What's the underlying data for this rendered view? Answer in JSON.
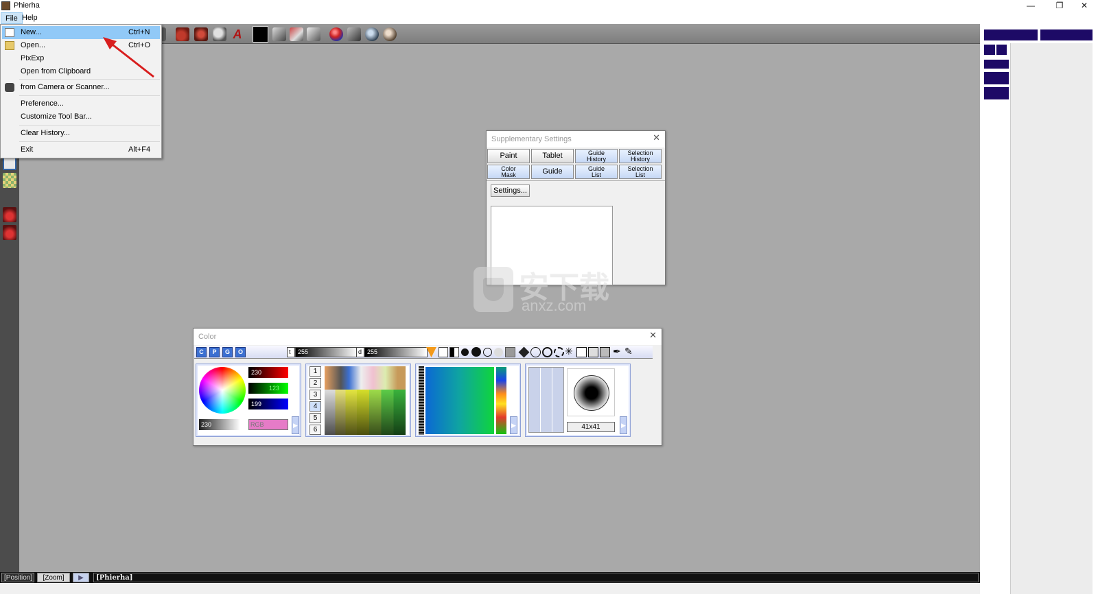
{
  "window": {
    "title": "Phierha",
    "minimize_glyph": "—",
    "restore_glyph": "❐",
    "close_glyph": "✕"
  },
  "menubar": {
    "file": "File",
    "help": "Help"
  },
  "file_menu": {
    "items": [
      {
        "label": "New...",
        "shortcut": "Ctrl+N",
        "icon": "new-document-icon"
      },
      {
        "label": "Open...",
        "shortcut": "Ctrl+O",
        "icon": "folder-icon"
      },
      {
        "label": "PixExp",
        "shortcut": ""
      },
      {
        "label": "Open from Clipboard",
        "shortcut": ""
      },
      {
        "label": "from Camera or Scanner...",
        "shortcut": "",
        "icon": "camera-icon"
      },
      {
        "label": "Preference...",
        "shortcut": ""
      },
      {
        "label": "Customize Tool Bar...",
        "shortcut": ""
      },
      {
        "label": "Clear History...",
        "shortcut": ""
      },
      {
        "label": "Exit",
        "shortcut": "Alt+F4"
      }
    ]
  },
  "supplementary": {
    "title": "Supplementary Settings",
    "buttons": {
      "paint": "Paint",
      "tablet": "Tablet",
      "guide_history_1": "Guide",
      "guide_history_2": "History",
      "selection_history_1": "Selection",
      "selection_history_2": "History",
      "color_mask_1": "Color",
      "color_mask_2": "Mask",
      "guide": "Guide",
      "guide_list_1": "Guide",
      "guide_list_2": "List",
      "selection_list_1": "Selection",
      "selection_list_2": "List"
    },
    "settings_button": "Settings..."
  },
  "color": {
    "title": "Color",
    "mode_buttons": [
      "C",
      "P",
      "G",
      "O"
    ],
    "slider_t_label": "t",
    "slider_t_value": "255",
    "slider_d_label": "d",
    "slider_d_value": "255",
    "r_value": "230",
    "g_value": "123",
    "b_value": "199",
    "gray_value": "230",
    "mode_label": "RGB",
    "palette_tabs": [
      "1",
      "2",
      "3",
      "4",
      "5",
      "6"
    ],
    "brush_size": "41x41",
    "accent": "#e67bc7"
  },
  "statusbar": {
    "position": "[Position]",
    "zoom": "[Zoom]",
    "app": "[Phierha]"
  },
  "watermark": {
    "text": "安下载",
    "sub": "anxz.com"
  }
}
